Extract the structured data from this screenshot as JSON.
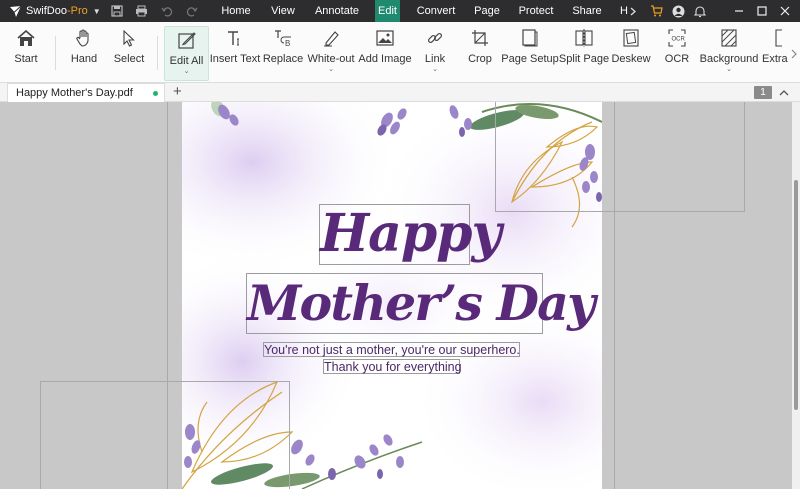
{
  "app": {
    "name": "SwifDoo",
    "edition": "-Pro"
  },
  "menu": {
    "items": [
      "Home",
      "View",
      "Annotate",
      "Edit",
      "Convert",
      "Page",
      "Protect",
      "Share",
      "H"
    ],
    "active": "Edit"
  },
  "toolbar": {
    "start": "Start",
    "hand": "Hand",
    "select": "Select",
    "edit_all": "Edit All",
    "insert_text": "Insert Text",
    "replace": "Replace",
    "white_out": "White-out",
    "add_image": "Add Image",
    "link": "Link",
    "crop": "Crop",
    "page_setup": "Page Setup",
    "split_page": "Split Page",
    "deskew": "Deskew",
    "ocr": "OCR",
    "background": "Background",
    "extra": "Extra"
  },
  "tabs": {
    "document": "Happy Mother's Day.pdf",
    "add": "+",
    "page_number": "1"
  },
  "document": {
    "title_line1": "Happy",
    "title_line2": "Mother’s Day",
    "subtitle": "You're not just a mother, you're our superhero.",
    "thanks": "Thank you for everything"
  },
  "colors": {
    "accent": "#1f8a6d",
    "titlebar": "#2d2d30",
    "title_text": "#5a2a7a",
    "leaf_gold": "#d4a443",
    "lavender": "#9b86c9"
  }
}
